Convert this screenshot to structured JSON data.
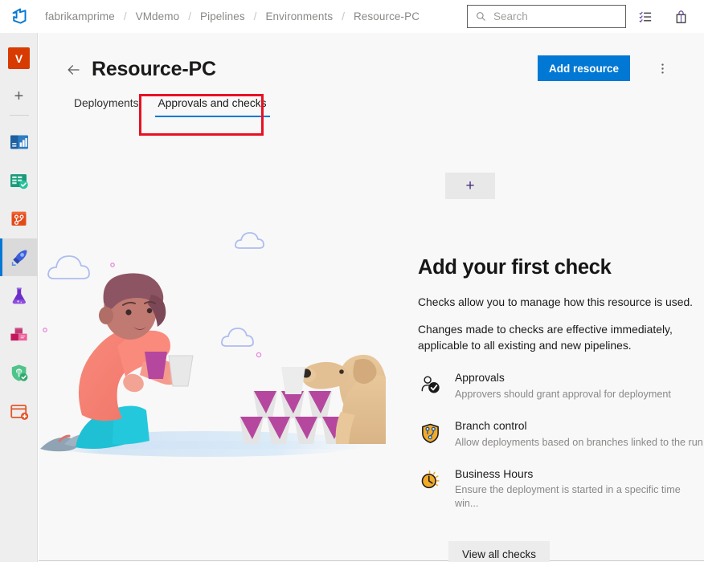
{
  "topbar": {
    "logo_icon": "azure-devops-logo-icon",
    "breadcrumb": [
      "fabrikamprime",
      "VMdemo",
      "Pipelines",
      "Environments",
      "Resource-PC"
    ],
    "separator": "/",
    "search": {
      "placeholder": "Search",
      "value": "",
      "icon": "search-icon"
    },
    "icons": [
      {
        "name": "checklist-icon",
        "label": "Checklist"
      },
      {
        "name": "shopping-bag-icon",
        "label": "Marketplace"
      }
    ]
  },
  "rail": {
    "avatar_initial": "V",
    "add_label": "+",
    "items": [
      {
        "name": "overview",
        "icon": "overview-icon",
        "selected": false
      },
      {
        "name": "boards",
        "icon": "boards-icon",
        "selected": false
      },
      {
        "name": "repos",
        "icon": "repos-icon",
        "selected": false
      },
      {
        "name": "pipelines",
        "icon": "pipelines-rocket-icon",
        "selected": true
      },
      {
        "name": "test-plans",
        "icon": "flask-icon",
        "selected": false
      },
      {
        "name": "artifacts",
        "icon": "artifacts-boxes-icon",
        "selected": false
      },
      {
        "name": "security",
        "icon": "shield-check-icon",
        "selected": false
      },
      {
        "name": "add-extension",
        "icon": "archive-add-icon",
        "selected": false
      }
    ]
  },
  "page": {
    "back_icon": "back-arrow-icon",
    "title": "Resource-PC",
    "add_resource_label": "Add resource",
    "more_icon": "more-vertical-icon",
    "accent_color": "#0078d4",
    "highlight_color": "#e81123"
  },
  "tabs": [
    {
      "label": "Deployments",
      "active": false
    },
    {
      "label": "Approvals and checks",
      "active": true
    }
  ],
  "plus_tile": {
    "label": "+",
    "icon": "plus-icon"
  },
  "illustration": {
    "name": "person-stacking-cups-with-dog-illustration",
    "clouds": 3
  },
  "empty_state": {
    "heading": "Add your first check",
    "paragraph1": "Checks allow you to manage how this resource is used.",
    "paragraph2": "Changes made to checks are effective immediately, applicable to all existing and new pipelines.",
    "checks": [
      {
        "icon": "approvals-person-check-icon",
        "name": "Approvals",
        "description": "Approvers should grant approval for deployment"
      },
      {
        "icon": "branch-control-shield-icon",
        "name": "Branch control",
        "description": "Allow deployments based on branches linked to the run"
      },
      {
        "icon": "business-hours-clock-icon",
        "name": "Business Hours",
        "description": "Ensure the deployment is started in a specific time win..."
      }
    ],
    "view_all_label": "View all checks"
  }
}
